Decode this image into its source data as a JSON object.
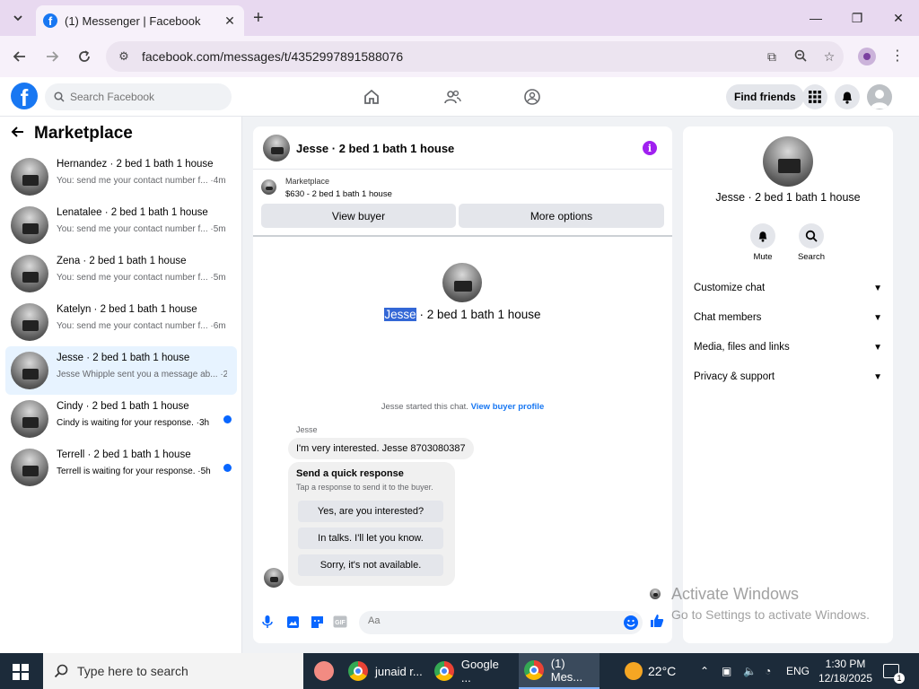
{
  "browser": {
    "tab_title": "(1) Messenger | Facebook",
    "url": "facebook.com/messages/t/4352997891588076"
  },
  "fb": {
    "search_placeholder": "Search Facebook",
    "find_friends": "Find friends"
  },
  "left": {
    "title": "Marketplace",
    "conversations": [
      {
        "name": "Hernandez · 2 bed 1 bath 1 house",
        "snippet": "You: send me your contact number f... ·4m",
        "unread": false,
        "active": false
      },
      {
        "name": "Lenatalee · 2 bed 1 bath 1 house",
        "snippet": "You: send me your contact number f... ·5m",
        "unread": false,
        "active": false
      },
      {
        "name": "Zena · 2 bed 1 bath 1 house",
        "snippet": "You: send me your contact number f... ·5m",
        "unread": false,
        "active": false
      },
      {
        "name": "Katelyn · 2 bed 1 bath 1 house",
        "snippet": "You: send me your contact number f... ·6m",
        "unread": false,
        "active": false
      },
      {
        "name": "Jesse · 2 bed 1 bath 1 house",
        "snippet": "Jesse Whipple sent you a message ab... ·2h",
        "unread": false,
        "active": true
      },
      {
        "name": "Cindy · 2 bed 1 bath 1 house",
        "snippet": "Cindy is waiting for your response. ·3h",
        "unread": true,
        "active": false
      },
      {
        "name": "Terrell · 2 bed 1 bath 1 house",
        "snippet": "Terrell is waiting for your response. ·5h",
        "unread": true,
        "active": false
      }
    ]
  },
  "chat": {
    "title": "Jesse · 2 bed 1 bath 1 house",
    "marketplace_label": "Marketplace",
    "listing": "$630 - 2 bed 1 bath 1 house",
    "view_buyer": "View buyer",
    "more_options": "More options",
    "center_name_highlight": "Jesse",
    "center_name_rest": " · 2 bed 1 bath 1 house",
    "started_text": "Jesse started this chat.",
    "view_buyer_profile": "View buyer profile",
    "sender": "Jesse",
    "message": "I'm very interested. Jesse 8703080387",
    "quick_title": "Send a quick response",
    "quick_sub": "Tap a response to send it to the buyer.",
    "quick_replies": [
      "Yes, are you interested?",
      "In talks. I'll let you know.",
      "Sorry, it's not available."
    ],
    "composer_placeholder": "Aa"
  },
  "right": {
    "name": "Jesse · 2 bed 1 bath 1 house",
    "mute": "Mute",
    "search": "Search",
    "items": [
      "Customize chat",
      "Chat members",
      "Media, files and links",
      "Privacy & support"
    ]
  },
  "watermark": {
    "line1": "Activate Windows",
    "line2": "Go to Settings to activate Windows."
  },
  "taskbar": {
    "search_placeholder": "Type here to search",
    "apps": [
      "junaid r...",
      "Google ...",
      "(1) Mes..."
    ],
    "weather": "22°C",
    "lang": "ENG",
    "time": "1:30 PM",
    "date": "12/18/2025",
    "notif_count": "1"
  }
}
